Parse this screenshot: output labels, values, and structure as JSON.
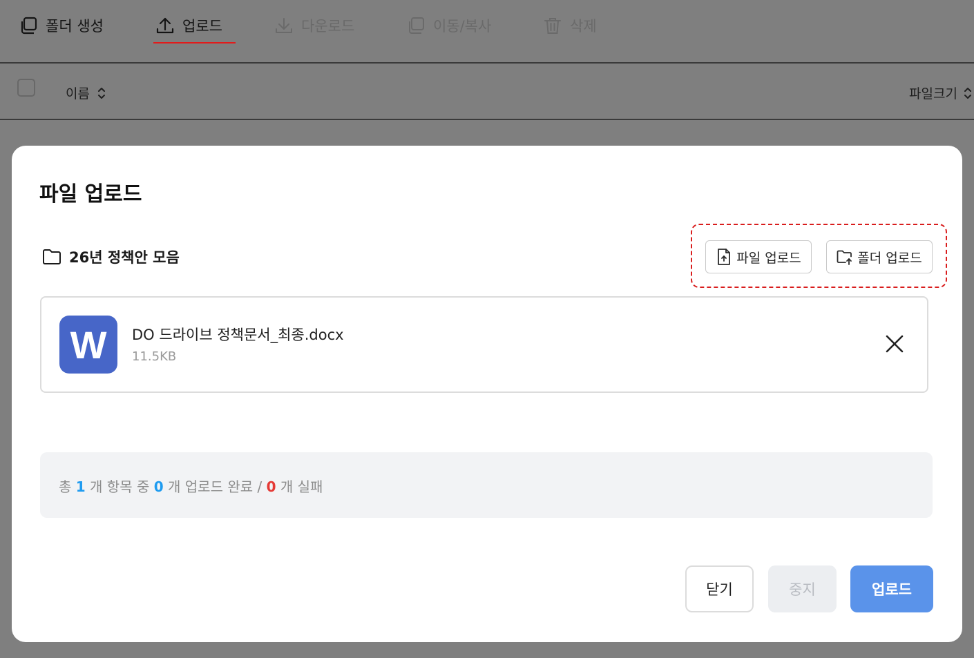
{
  "toolbar": {
    "create_folder": "폴더 생성",
    "upload": "업로드",
    "download": "다운로드",
    "move_copy": "이동/복사",
    "delete": "삭제"
  },
  "list_header": {
    "name": "이름",
    "file_size": "파일크기"
  },
  "modal": {
    "title": "파일 업로드",
    "folder_path": "26년 정책안 모음",
    "file_upload_button": "파일 업로드",
    "folder_upload_button": "폴더 업로드",
    "files": [
      {
        "icon_letter": "W",
        "name": "DO 드라이브 정책문서_최종.docx",
        "size": "11.5KB"
      }
    ],
    "summary": {
      "prefix": "총",
      "total": "1",
      "items_in": "개 항목 중",
      "done": "0",
      "done_label": "개 업로드 완료 /",
      "failed": "0",
      "failed_label": "개 실패"
    },
    "buttons": {
      "close": "닫기",
      "stop": "중지",
      "upload": "업로드"
    }
  },
  "colors": {
    "accent_blue": "#5a93ea",
    "highlight_red": "#d91d1d",
    "word_icon": "#4766c8"
  }
}
